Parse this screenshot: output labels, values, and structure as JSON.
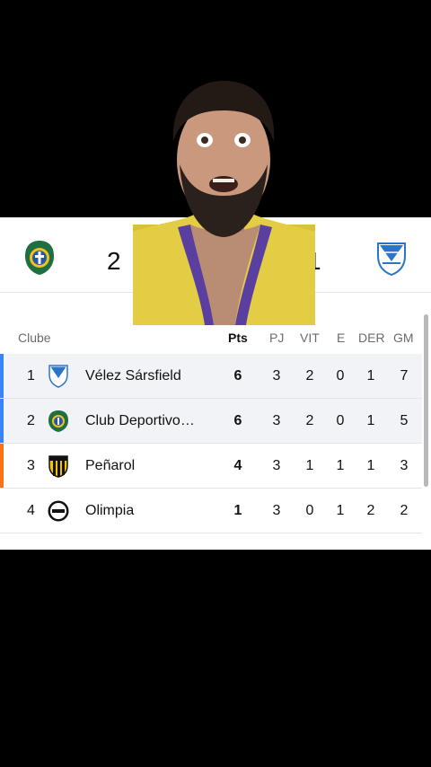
{
  "score": {
    "home": "2",
    "away": "1"
  },
  "table": {
    "headers": {
      "club": "Clube",
      "pts": "Pts",
      "pj": "PJ",
      "vit": "VIT",
      "e": "E",
      "der": "DER",
      "gm": "GM"
    },
    "rows": [
      {
        "pos": "1",
        "name": "Vélez Sársfield",
        "pts": "6",
        "pj": "3",
        "vit": "2",
        "e": "0",
        "der": "1",
        "gm": "7"
      },
      {
        "pos": "2",
        "name": "Club Deportivo Liniers",
        "pts": "6",
        "pj": "3",
        "vit": "2",
        "e": "0",
        "der": "1",
        "gm": "5"
      },
      {
        "pos": "3",
        "name": "Peñarol",
        "pts": "4",
        "pj": "3",
        "vit": "1",
        "e": "1",
        "der": "1",
        "gm": "3"
      },
      {
        "pos": "4",
        "name": "Olimpia",
        "pts": "1",
        "pj": "3",
        "vit": "0",
        "e": "1",
        "der": "2",
        "gm": "2"
      }
    ]
  },
  "colors": {
    "qualify": "#3b82f6",
    "playoff": "#f97316",
    "brand_green": "#1f6f43"
  },
  "icons": [
    "club-deportivo-crest-icon",
    "velez-crest-icon",
    "penarol-crest-icon",
    "olimpia-crest-icon"
  ]
}
